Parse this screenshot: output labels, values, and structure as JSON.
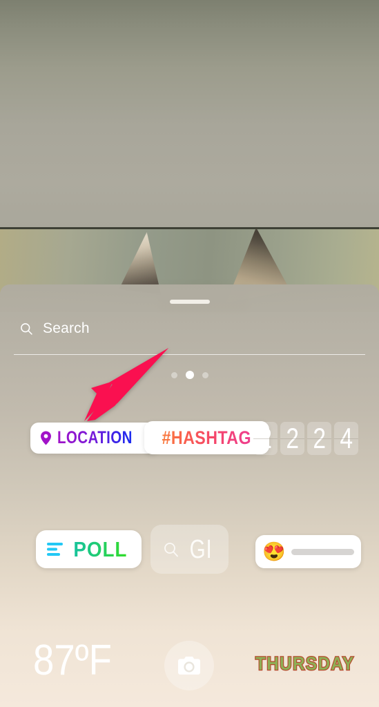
{
  "screen": {
    "app": "instagram-story-sticker-tray",
    "background_photo_description": "blurred photo of a cat's ears against a gray-green wall"
  },
  "colors": {
    "arrow_annotation": "#fa1050",
    "location_gradient_start": "#a113c8",
    "location_gradient_end": "#1b2ef0",
    "hashtag_gradient_start": "#f97c3c",
    "hashtag_gradient_end": "#ee3f8f",
    "poll_gradient_start": "#17c39c",
    "poll_gradient_end": "#32dd28",
    "weekday_fill": "#8fae55",
    "weekday_outline": "#b4482a",
    "slider_track": "#d6d4d2",
    "chip_background": "#ffffff"
  },
  "tray": {
    "grabber": "drag-handle",
    "search": {
      "icon": "search-icon",
      "placeholder": "Search",
      "value": ""
    },
    "pagination": {
      "total": 3,
      "active_index": 1
    }
  },
  "annotation": {
    "arrow": "arrow-pointing-down-left",
    "target": "LOCATION"
  },
  "stickers": {
    "location": {
      "icon": "location-pin-icon",
      "label": "LOCATION"
    },
    "hashtag": {
      "label": "#HASHTAG"
    },
    "countdown": {
      "label": "countdown-flip-digits",
      "digits": [
        "2",
        "2",
        "2",
        "4"
      ]
    },
    "poll": {
      "icon": "poll-bars-icon",
      "label": "POLL"
    },
    "gif": {
      "icon": "search-icon",
      "label": "GI"
    },
    "emoji_slider": {
      "emoji": "😍",
      "track": "slider-track"
    },
    "temperature": {
      "label": "87ºF"
    },
    "camera": {
      "icon": "camera-icon"
    },
    "weekday": {
      "label": "THURSDAY"
    }
  }
}
